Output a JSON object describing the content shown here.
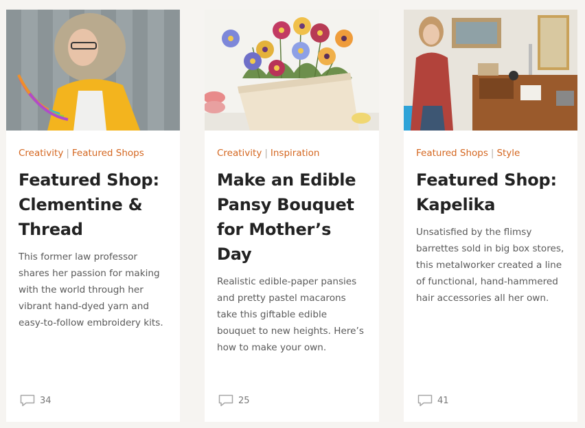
{
  "cards": [
    {
      "categories": [
        "Creativity",
        "Featured Shops"
      ],
      "separator": "|",
      "title": "Featured Shop: Clementine & Thread",
      "description": "This former law professor shares her passion for making with the world through her vibrant hand-dyed yarn and easy-to-follow embroidery kits.",
      "comment_count": "34",
      "photo": "woman-with-yarn"
    },
    {
      "categories": [
        "Creativity",
        "Inspiration"
      ],
      "separator": "|",
      "title": "Make an Edible Pansy Bouquet for Mother’s Day",
      "description": "Realistic edible-paper pansies and pretty pastel macarons take this giftable edible bouquet to new heights. Here’s how to make your own.",
      "comment_count": "25",
      "photo": "pansy-bouquet"
    },
    {
      "categories": [
        "Featured Shops",
        "Style"
      ],
      "separator": "|",
      "title": "Featured Shop: Kapelika",
      "description": "Unsatisfied by the flimsy barrettes sold in big box stores, this metalworker created a line of functional, hand-hammered hair accessories all her own.",
      "comment_count": "41",
      "photo": "woman-in-workshop"
    }
  ],
  "colors": {
    "accent": "#d4661f",
    "title": "#222222",
    "text": "#595959",
    "background": "#f6f4f1"
  }
}
